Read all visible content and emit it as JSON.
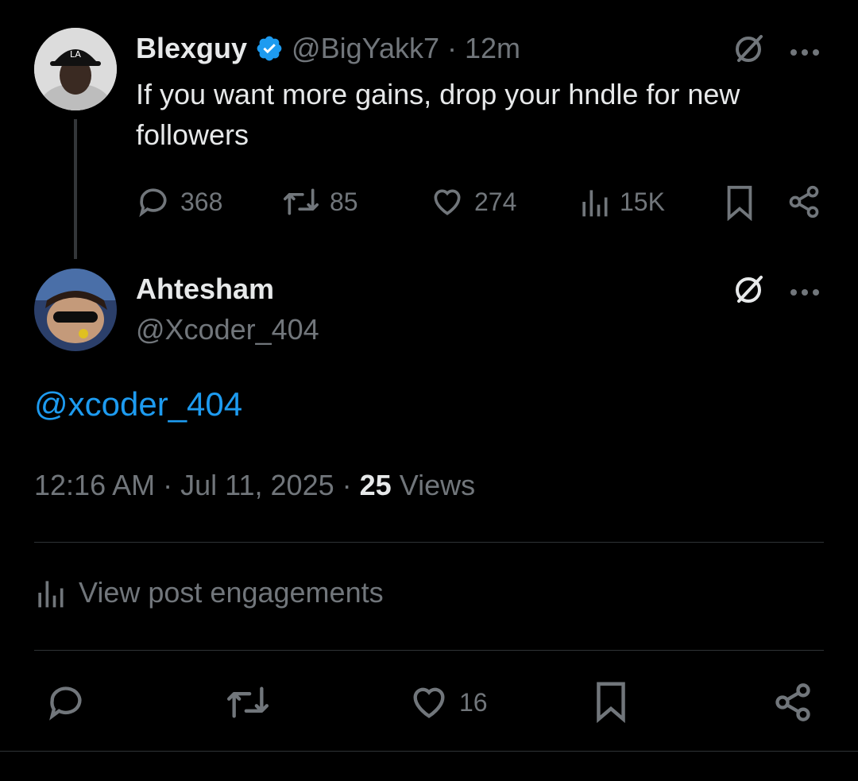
{
  "parent_post": {
    "author_name": "Blexguy",
    "handle": "@BigYakk7",
    "separator": "·",
    "time": "12m",
    "text": "If you want more gains, drop your hndle for new followers",
    "stats": {
      "replies": "368",
      "reposts": "85",
      "likes": "274",
      "views": "15K"
    }
  },
  "reply_post": {
    "author_name": "Ahtesham",
    "handle": "@Xcoder_404",
    "mention": "@xcoder_404",
    "time": "12:16 AM",
    "sep1": "·",
    "date": "Jul 11, 2025",
    "sep2": "·",
    "views_count": "25",
    "views_label": "Views",
    "engagements_label": "View post engagements",
    "likes": "16"
  },
  "colors": {
    "background": "#000000",
    "text": "#e7e9ea",
    "muted": "#71767b",
    "link": "#1d9bf0",
    "verified": "#1d9bf0",
    "divider": "#2f3336"
  }
}
